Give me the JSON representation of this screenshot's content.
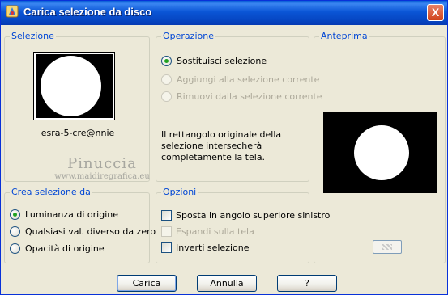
{
  "window": {
    "title": "Carica selezione da disco",
    "close_label": "X"
  },
  "selezione": {
    "legend": "Selezione",
    "file_name": "esra-5-cre@nnie"
  },
  "watermark": {
    "line1": "Pinuccia",
    "line2": "www.maidiregrafica.eu"
  },
  "crea": {
    "legend": "Crea selezione da",
    "options": [
      {
        "label": "Luminanza di origine",
        "selected": true
      },
      {
        "label": "Qualsiasi val. diverso da zero",
        "selected": false
      },
      {
        "label": "Opacità di origine",
        "selected": false
      }
    ]
  },
  "operazione": {
    "legend": "Operazione",
    "options": [
      {
        "label": "Sostituisci selezione",
        "selected": true,
        "enabled": true
      },
      {
        "label": "Aggiungi alla selezione corrente",
        "selected": false,
        "enabled": false
      },
      {
        "label": "Rimuovi dalla selezione corrente",
        "selected": false,
        "enabled": false
      }
    ],
    "info": "Il rettangolo originale della selezione intersecherà completamente la tela."
  },
  "opzioni": {
    "legend": "Opzioni",
    "checks": [
      {
        "label": "Sposta in angolo superiore sinistro",
        "checked": false,
        "enabled": true
      },
      {
        "label": "Espandi sulla tela",
        "checked": false,
        "enabled": false
      },
      {
        "label": "Inverti selezione",
        "checked": false,
        "enabled": true
      }
    ]
  },
  "anteprima": {
    "legend": "Anteprima"
  },
  "buttons": {
    "carica": "Carica",
    "annulla": "Annulla",
    "help": "?"
  },
  "colors": {
    "titlebar": "#0a55d6",
    "legend": "#0046d5",
    "dialog_bg": "#ece9d8"
  }
}
